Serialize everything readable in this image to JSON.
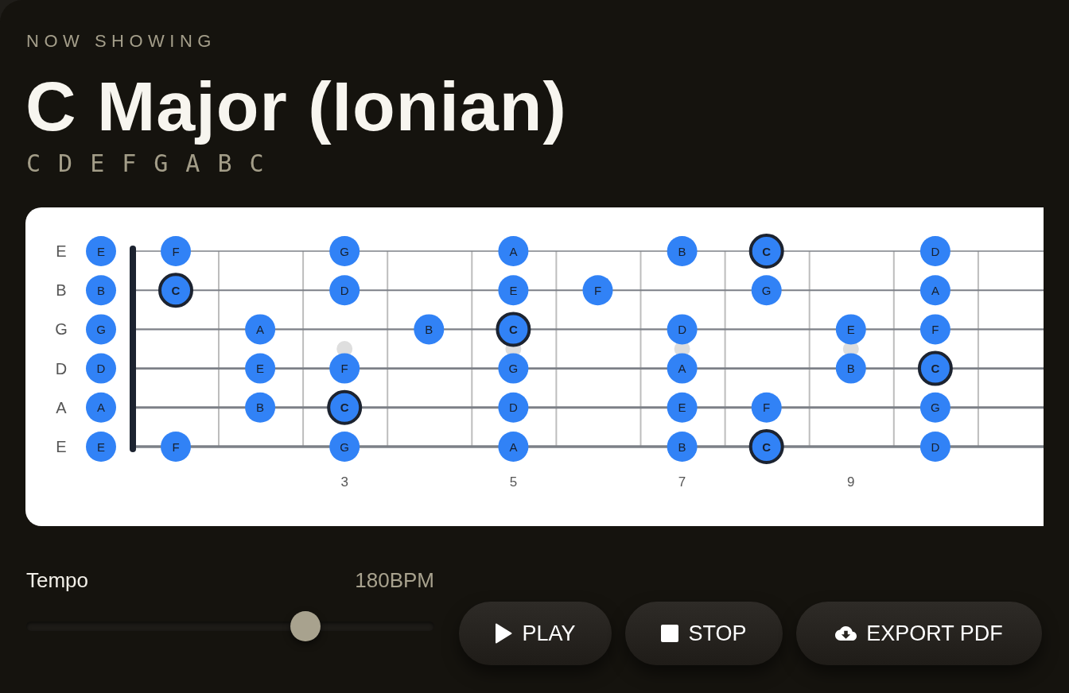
{
  "header": {
    "eyebrow": "NOW SHOWING",
    "title": "C Major (Ionian)",
    "scale_notes": [
      "C",
      "D",
      "E",
      "F",
      "G",
      "A",
      "B",
      "C"
    ]
  },
  "fretboard": {
    "columns": [
      {
        "kind": "plain"
      },
      {
        "kind": "plain"
      },
      {
        "kind": "marked",
        "fret_label": "3"
      },
      {
        "kind": "plain"
      },
      {
        "kind": "marked",
        "fret_label": "5"
      },
      {
        "kind": "plain"
      },
      {
        "kind": "marked",
        "fret_label": "7"
      },
      {
        "kind": "plain"
      },
      {
        "kind": "marked",
        "fret_label": "9"
      },
      {
        "kind": "plain"
      }
    ],
    "strings": [
      {
        "label": "E",
        "slots": [
          {
            "kind": "note",
            "note": "E",
            "root": false
          },
          {
            "kind": "note",
            "note": "F",
            "root": false
          },
          {
            "kind": "empty"
          },
          {
            "kind": "note",
            "note": "G",
            "root": false
          },
          {
            "kind": "empty"
          },
          {
            "kind": "note",
            "note": "A",
            "root": false
          },
          {
            "kind": "empty"
          },
          {
            "kind": "note",
            "note": "B",
            "root": false
          },
          {
            "kind": "note",
            "note": "C",
            "root": true
          },
          {
            "kind": "empty"
          },
          {
            "kind": "note",
            "note": "D",
            "root": false
          }
        ]
      },
      {
        "label": "B",
        "slots": [
          {
            "kind": "note",
            "note": "B",
            "root": false
          },
          {
            "kind": "note",
            "note": "C",
            "root": true
          },
          {
            "kind": "empty"
          },
          {
            "kind": "note",
            "note": "D",
            "root": false
          },
          {
            "kind": "empty"
          },
          {
            "kind": "note",
            "note": "E",
            "root": false
          },
          {
            "kind": "note",
            "note": "F",
            "root": false
          },
          {
            "kind": "empty"
          },
          {
            "kind": "note",
            "note": "G",
            "root": false
          },
          {
            "kind": "empty"
          },
          {
            "kind": "note",
            "note": "A",
            "root": false
          }
        ]
      },
      {
        "label": "G",
        "slots": [
          {
            "kind": "note",
            "note": "G",
            "root": false
          },
          {
            "kind": "empty"
          },
          {
            "kind": "note",
            "note": "A",
            "root": false
          },
          {
            "kind": "empty"
          },
          {
            "kind": "note",
            "note": "B",
            "root": false
          },
          {
            "kind": "note",
            "note": "C",
            "root": true
          },
          {
            "kind": "empty"
          },
          {
            "kind": "note",
            "note": "D",
            "root": false
          },
          {
            "kind": "empty"
          },
          {
            "kind": "note",
            "note": "E",
            "root": false
          },
          {
            "kind": "note",
            "note": "F",
            "root": false
          }
        ]
      },
      {
        "label": "D",
        "slots": [
          {
            "kind": "note",
            "note": "D",
            "root": false
          },
          {
            "kind": "empty"
          },
          {
            "kind": "note",
            "note": "E",
            "root": false
          },
          {
            "kind": "note",
            "note": "F",
            "root": false
          },
          {
            "kind": "empty"
          },
          {
            "kind": "note",
            "note": "G",
            "root": false
          },
          {
            "kind": "empty"
          },
          {
            "kind": "note",
            "note": "A",
            "root": false
          },
          {
            "kind": "empty"
          },
          {
            "kind": "note",
            "note": "B",
            "root": false
          },
          {
            "kind": "note",
            "note": "C",
            "root": true
          }
        ]
      },
      {
        "label": "A",
        "slots": [
          {
            "kind": "note",
            "note": "A",
            "root": false
          },
          {
            "kind": "empty"
          },
          {
            "kind": "note",
            "note": "B",
            "root": false
          },
          {
            "kind": "note",
            "note": "C",
            "root": true
          },
          {
            "kind": "empty"
          },
          {
            "kind": "note",
            "note": "D",
            "root": false
          },
          {
            "kind": "empty"
          },
          {
            "kind": "note",
            "note": "E",
            "root": false
          },
          {
            "kind": "note",
            "note": "F",
            "root": false
          },
          {
            "kind": "empty"
          },
          {
            "kind": "note",
            "note": "G",
            "root": false
          }
        ]
      },
      {
        "label": "E",
        "slots": [
          {
            "kind": "note",
            "note": "E",
            "root": false
          },
          {
            "kind": "note",
            "note": "F",
            "root": false
          },
          {
            "kind": "empty"
          },
          {
            "kind": "note",
            "note": "G",
            "root": false
          },
          {
            "kind": "empty"
          },
          {
            "kind": "note",
            "note": "A",
            "root": false
          },
          {
            "kind": "empty"
          },
          {
            "kind": "note",
            "note": "B",
            "root": false
          },
          {
            "kind": "note",
            "note": "C",
            "root": true
          },
          {
            "kind": "empty"
          },
          {
            "kind": "note",
            "note": "D",
            "root": false
          }
        ]
      }
    ]
  },
  "tempo": {
    "label": "Tempo",
    "reading": "180BPM",
    "level": 0.684
  },
  "buttons": [
    {
      "kind": "play",
      "label": "PLAY"
    },
    {
      "kind": "stop",
      "label": "STOP"
    },
    {
      "kind": "export",
      "label": "EXPORT PDF"
    }
  ]
}
